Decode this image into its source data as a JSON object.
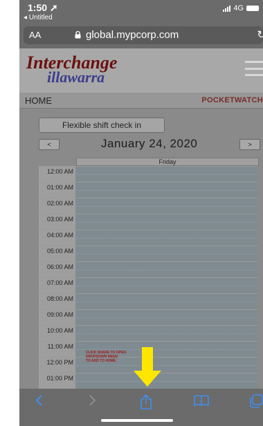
{
  "status": {
    "time": "1:50 ➚",
    "back": "◂ Untitled",
    "network": "4G"
  },
  "browser": {
    "text_size": "AA",
    "url": "global.mypcorp.com"
  },
  "site": {
    "logo_line1": "Interchange",
    "logo_line2": "illawarra",
    "home": "HOME",
    "brand": "POCKETWATCH"
  },
  "calendar": {
    "button": "Flexible shift check in",
    "prev": "<",
    "next": ">",
    "date": "January 24, 2020",
    "day": "Friday",
    "times": [
      "12:00 AM",
      "01:00 AM",
      "02:00 AM",
      "03:00 AM",
      "04:00 AM",
      "05:00 AM",
      "06:00 AM",
      "07:00 AM",
      "08:00 AM",
      "09:00 AM",
      "10:00 AM",
      "11:00 AM",
      "12:00 PM",
      "01:00 PM"
    ]
  },
  "annotation": {
    "line1": "CLICK SHARE TO OPEN",
    "line2": "DROPDOWN MENU",
    "line3": "TO ADD TO HOME",
    "arrow_color": "#ffe600"
  },
  "colors": {
    "toolbar_accent": "#3f8ef0"
  },
  "toolbar": {
    "back_icon": "back-icon",
    "forward_icon": "forward-icon",
    "share_icon": "share-icon",
    "bookmarks_icon": "book-icon",
    "tabs_icon": "tabs-icon"
  }
}
